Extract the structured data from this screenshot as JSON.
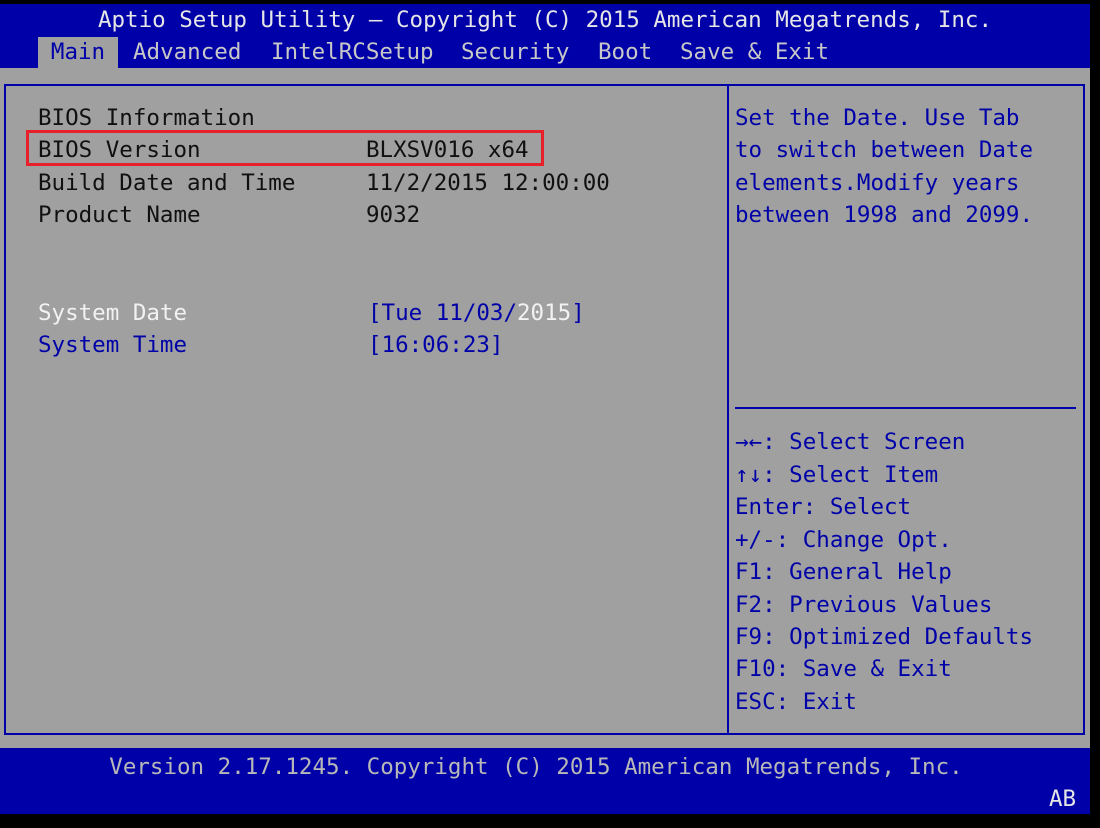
{
  "header": {
    "title": "Aptio Setup Utility – Copyright (C) 2015 American Megatrends, Inc.",
    "tabs": [
      {
        "label": "Main",
        "active": true
      },
      {
        "label": "Advanced"
      },
      {
        "label": "IntelRCSetup"
      },
      {
        "label": "Security"
      },
      {
        "label": "Boot"
      },
      {
        "label": "Save & Exit"
      }
    ]
  },
  "main": {
    "section_title": "BIOS Information",
    "info": [
      {
        "label": "BIOS Version",
        "value": "BLXSV016 x64"
      },
      {
        "label": "Build Date and Time",
        "value": "11/2/2015 12:00:00"
      },
      {
        "label": "Product Name",
        "value": "9032"
      }
    ],
    "system_date": {
      "label": "System Date",
      "value_prefix": "[Tue 11/03/",
      "value_selected": "2015",
      "value_suffix": "]"
    },
    "system_time": {
      "label": "System Time",
      "value": "[16:06:23]"
    }
  },
  "help": {
    "lines": [
      "Set the Date. Use Tab",
      "to switch between Date",
      "elements.Modify years",
      "between 1998 and 2099."
    ]
  },
  "keys": [
    "→←: Select Screen",
    "↑↓: Select Item",
    "Enter: Select",
    "+/-: Change Opt.",
    "F1: General Help",
    "F2: Previous Values",
    "F9: Optimized Defaults",
    "F10: Save & Exit",
    "ESC: Exit"
  ],
  "footer": {
    "version": "Version 2.17.1245. Copyright (C) 2015 American Megatrends, Inc.",
    "badge": "AB"
  },
  "colors": {
    "blue": "#0000a8",
    "gray": "#a0a0a0",
    "highlight_border": "#e8202a"
  }
}
